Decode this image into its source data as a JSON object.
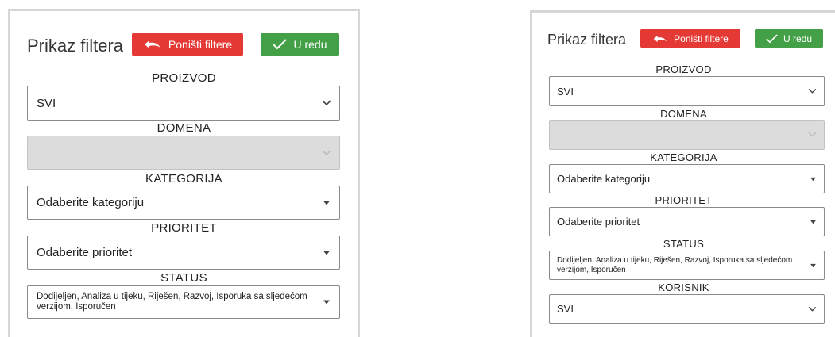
{
  "filter_panel": {
    "title": "Prikaz filtera",
    "reset_label": "Poništi filtere",
    "ok_label": "U redu",
    "product": {
      "label": "PROIZVOD",
      "value": "SVI"
    },
    "domain": {
      "label": "DOMENA",
      "value": ""
    },
    "category": {
      "label": "KATEGORIJA",
      "value": "Odaberite kategoriju"
    },
    "priority": {
      "label": "PRIORITET",
      "value": "Odaberite prioritet"
    },
    "status": {
      "label": "STATUS",
      "value": "Dodijeljen, Analiza u tijeku, Riješen, Razvoj, Isporuka sa sljedećom verzijom, Isporučen"
    },
    "user": {
      "label": "KORISNIK",
      "value": "SVI"
    }
  },
  "colors": {
    "reset_button": "#e53935",
    "ok_button": "#43a047",
    "disabled_field": "#dcdcdc",
    "panel_border": "#d6d6d6"
  },
  "icons": {
    "reset": "undo-arrow-icon",
    "ok": "checkmark-icon",
    "dropdown_open": "chevron-down-icon",
    "dropdown_native": "caret-down-icon"
  }
}
